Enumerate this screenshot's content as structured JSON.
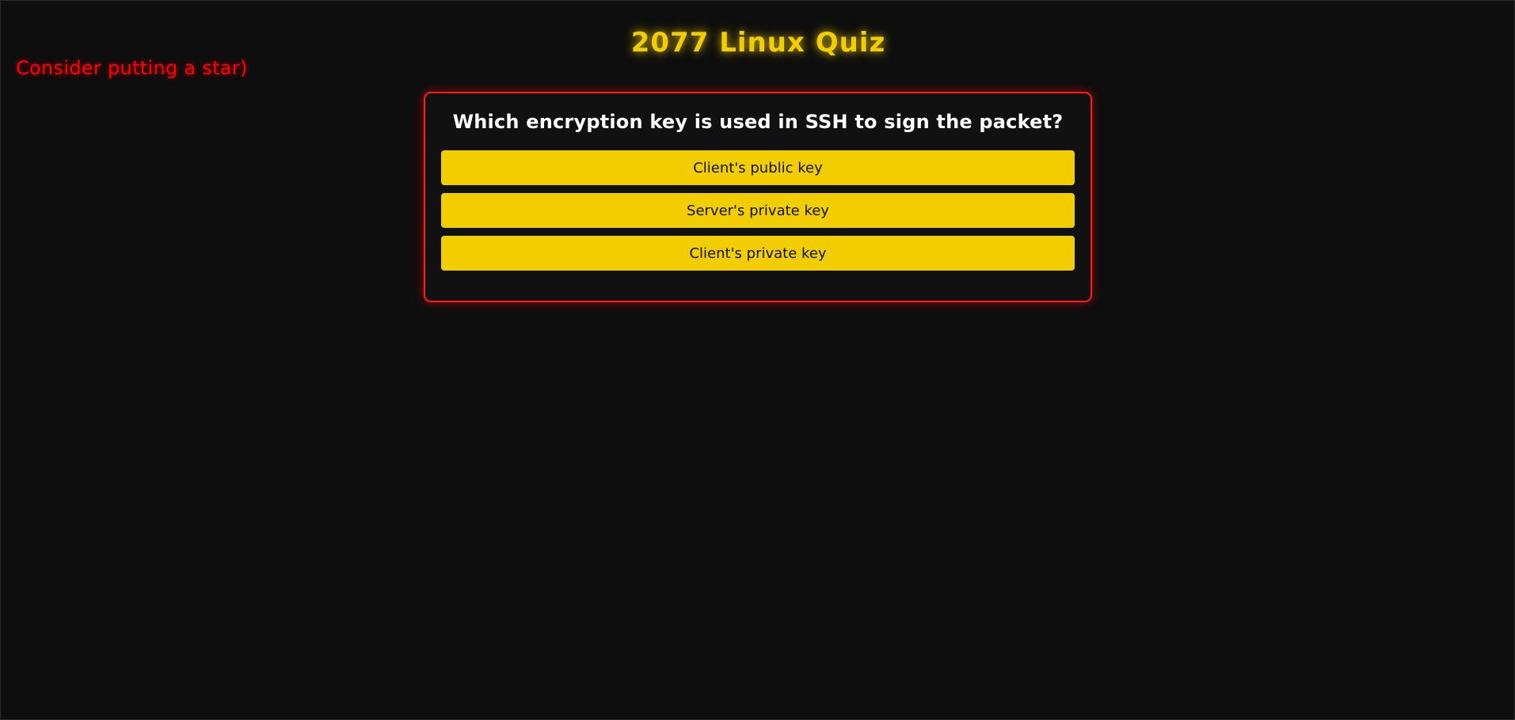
{
  "page": {
    "title": "2077 Linux Quiz",
    "star_note": "Consider putting a star)"
  },
  "quiz": {
    "question": "Which encryption key is used in SSH to sign the packet?",
    "answers": [
      {
        "label": "Client's public key"
      },
      {
        "label": "Server's private key"
      },
      {
        "label": "Client's private key"
      }
    ]
  },
  "colors": {
    "background": "#0e0e0e",
    "accent_yellow": "#f2cd00",
    "accent_red": "#ff1a1a",
    "question_text": "#ffffff",
    "button_text": "#111111"
  }
}
